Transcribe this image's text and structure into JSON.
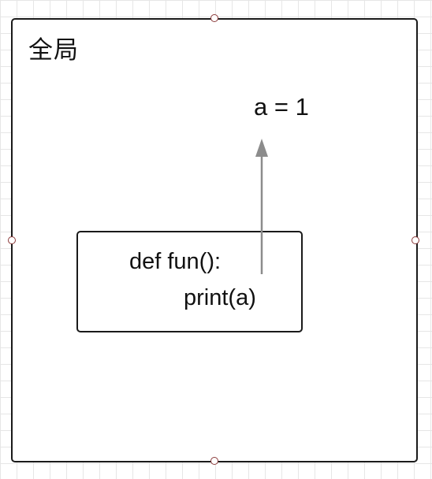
{
  "diagram": {
    "scope_label": "全局",
    "variable_assignment": "a = 1",
    "function_code": {
      "line1": "def fun():",
      "line2": "print(a)"
    },
    "colors": {
      "border": "#1a1a1a",
      "arrow": "#8c8c8c",
      "grid": "#e6e6e6",
      "handle": "#8b3a3a"
    },
    "icons": {
      "arrow": "arrow-up-icon",
      "handle": "resize-handle-icon"
    }
  }
}
